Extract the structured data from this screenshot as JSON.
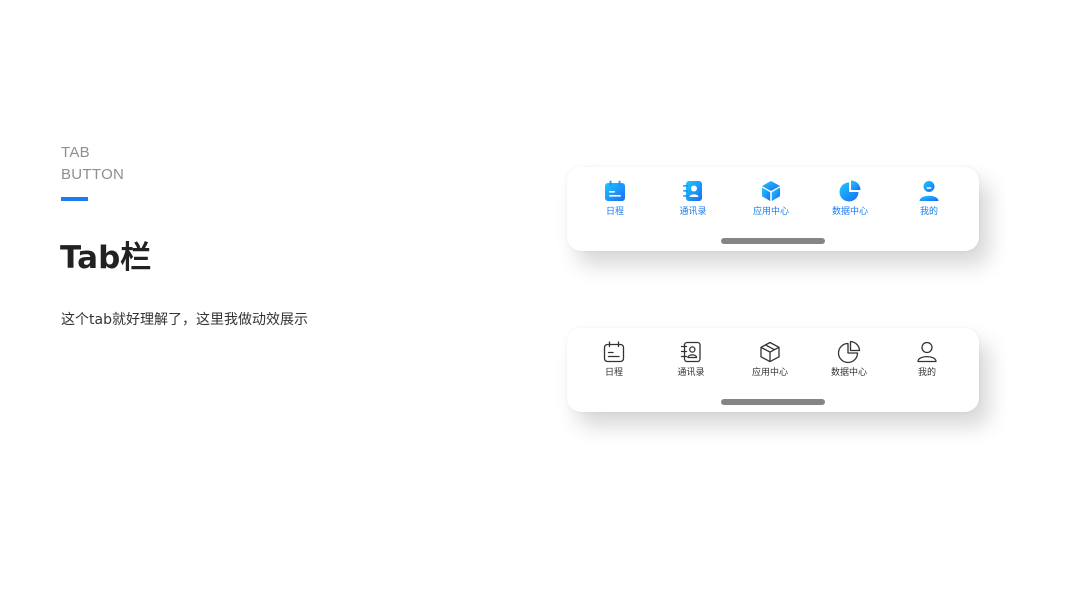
{
  "header": {
    "eyebrow_line1": "TAB",
    "eyebrow_line2": "BUTTON",
    "title": "Tab栏",
    "description": "这个tab就好理解了，这里我做动效展示"
  },
  "colors": {
    "accent": "#1a7cf0",
    "gradient_start": "#1ec8ff",
    "gradient_end": "#1a6cf5",
    "icon_outline": "#333333",
    "home_indicator": "#858585"
  },
  "tabbar_active": {
    "state": "selected / filled icons",
    "tabs": [
      {
        "label": "日程",
        "icon": "calendar-icon"
      },
      {
        "label": "通讯录",
        "icon": "contacts-book-icon"
      },
      {
        "label": "应用中心",
        "icon": "cube-icon"
      },
      {
        "label": "数据中心",
        "icon": "pie-chart-icon"
      },
      {
        "label": "我的",
        "icon": "user-icon"
      }
    ]
  },
  "tabbar_default": {
    "state": "unselected / outline icons",
    "tabs": [
      {
        "label": "日程",
        "icon": "calendar-icon"
      },
      {
        "label": "通讯录",
        "icon": "contacts-book-icon"
      },
      {
        "label": "应用中心",
        "icon": "cube-icon"
      },
      {
        "label": "数据中心",
        "icon": "pie-chart-icon"
      },
      {
        "label": "我的",
        "icon": "user-icon"
      }
    ]
  }
}
